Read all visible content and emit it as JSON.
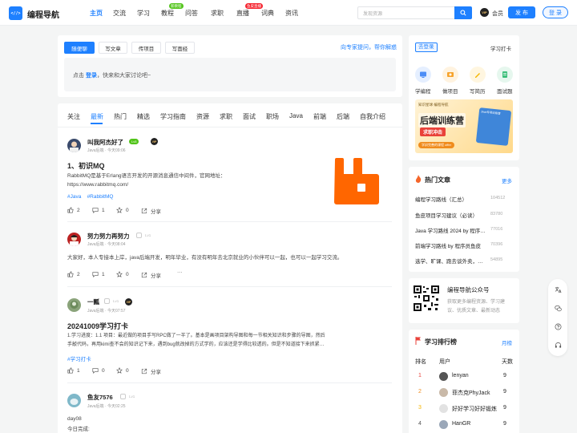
{
  "header": {
    "logo_mark": "<//>",
    "logo_text": "编程导航",
    "nav": [
      {
        "label": "主页",
        "active": true
      },
      {
        "label": "交流"
      },
      {
        "label": "学习"
      },
      {
        "label": "教程",
        "badge": "新教程"
      },
      {
        "label": "问答"
      },
      {
        "label": "求职"
      },
      {
        "label": "直播",
        "badge": "鱼皮直播"
      },
      {
        "label": "词典"
      },
      {
        "label": "资讯"
      }
    ],
    "search_placeholder": "发现资源",
    "vip_badge": "VIP",
    "vip_label": "会员",
    "publish_label": "发 布",
    "login_label": "登 录"
  },
  "composer": {
    "tabs": [
      "随便聊",
      "写文章",
      "传项目",
      "写面经"
    ],
    "ask_link": "向专家提问，帮你解惑",
    "prompt_prefix": "点击",
    "prompt_link": "登录",
    "prompt_suffix": "，快来和大家讨论吧~"
  },
  "feed": {
    "tabs": [
      "关注",
      "最新",
      "热门",
      "精选",
      "学习指南",
      "资源",
      "求职",
      "面试",
      "职场",
      "Java",
      "前端",
      "后端",
      "自我介绍"
    ],
    "posts": [
      {
        "user": "叫我阿杰好了",
        "level": "Lv5",
        "level_color": "#52c41a",
        "meta": "Java后端 · 今天09:06",
        "vip": true,
        "title": "1、初识MQ",
        "lines": [
          "RabbitMQ是基于Erlang语言开发的开源消息通信中间件，官网地址：",
          "https://www.rabbitmq.com/"
        ],
        "tags": "#Java    #RabbitMQ",
        "likes": "2",
        "comments": "1",
        "stars": "0",
        "share": "分享"
      },
      {
        "user": "努力努力再努力",
        "level": "Lv1",
        "meta": "Java后端 · 今天08:04",
        "lines": [
          "大家好，本人专接本上岸，java后端开发，明年毕业，有没有明年去北京就业的小伙伴可以一起，也可以一起学习交流。"
        ],
        "likes": "2",
        "comments": "1",
        "stars": "0",
        "share": "分享",
        "more": "···"
      },
      {
        "user": "一瓢",
        "level": "Lv1",
        "meta": "Java后端 · 今天07:57",
        "vip": true,
        "title": "20241009学习打卡",
        "lines": [
          "1.学习进度：1.1 项目：最近做的项目手写RPC做了一半了。基本是画项目架构导图和每一节相关知识和步骤的导图，然后",
          "手敲代码，再用kimi查不会的知识记下来，遇到bug就改掉的方式学的，应该还是学得比较透的。但是不知道接下来抓紧…"
        ],
        "tags": "#学习打卡",
        "likes": "1",
        "comments": "0",
        "stars": "0",
        "share": "分享"
      },
      {
        "user": "鱼友7576",
        "level": "Lv1",
        "meta": "Java后端 · 今天02:25",
        "lines": [
          "day08",
          "今日完成:"
        ]
      }
    ]
  },
  "sidebar": {
    "quick": {
      "login_tag": "去登录",
      "card_label": "学习打卡",
      "items": [
        "学编程",
        "做项目",
        "写简历",
        "面试题"
      ]
    },
    "banner": {
      "top": "知识星球·编程导航",
      "main": "后端训练营",
      "sub": "求职冲击",
      "side": "Java专项训练营",
      "cta": "学训完善的课程 offer"
    },
    "hot": {
      "title": "热门文章",
      "more": "更多",
      "items": [
        {
          "title": "编程学习路线（汇总）",
          "count": "104512"
        },
        {
          "title": "鱼皮项目学习建议（必读）",
          "count": "83780"
        },
        {
          "title": "Java 学习路线 2024 by 程序…",
          "count": "77016"
        },
        {
          "title": "前端学习路线 by 程序员鱼皮",
          "count": "70396"
        },
        {
          "title": "选学、旷课、跑去谈外卖，…",
          "count": "54895"
        }
      ]
    },
    "wechat": {
      "title": "编程导航公众号",
      "desc": [
        "获取更多编程资源、学习建",
        "议、优质文章、最新动态"
      ]
    },
    "rank": {
      "title": "学习排行榜",
      "period": "月榜",
      "headers": [
        "排名",
        "用户",
        "天数"
      ],
      "rows": [
        {
          "rank": "1",
          "user": "lenyan",
          "days": "9"
        },
        {
          "rank": "2",
          "user": "菲杰克PhyJack",
          "days": "9"
        },
        {
          "rank": "3",
          "user": "好好学习好好锻炼",
          "days": "9"
        },
        {
          "rank": "4",
          "user": "HanGR",
          "days": "9"
        }
      ]
    }
  },
  "colors": {
    "accent": "#1e80ff",
    "rank1": "#e9423a",
    "rank2": "#f08c1d",
    "rank3": "#f5b500"
  }
}
